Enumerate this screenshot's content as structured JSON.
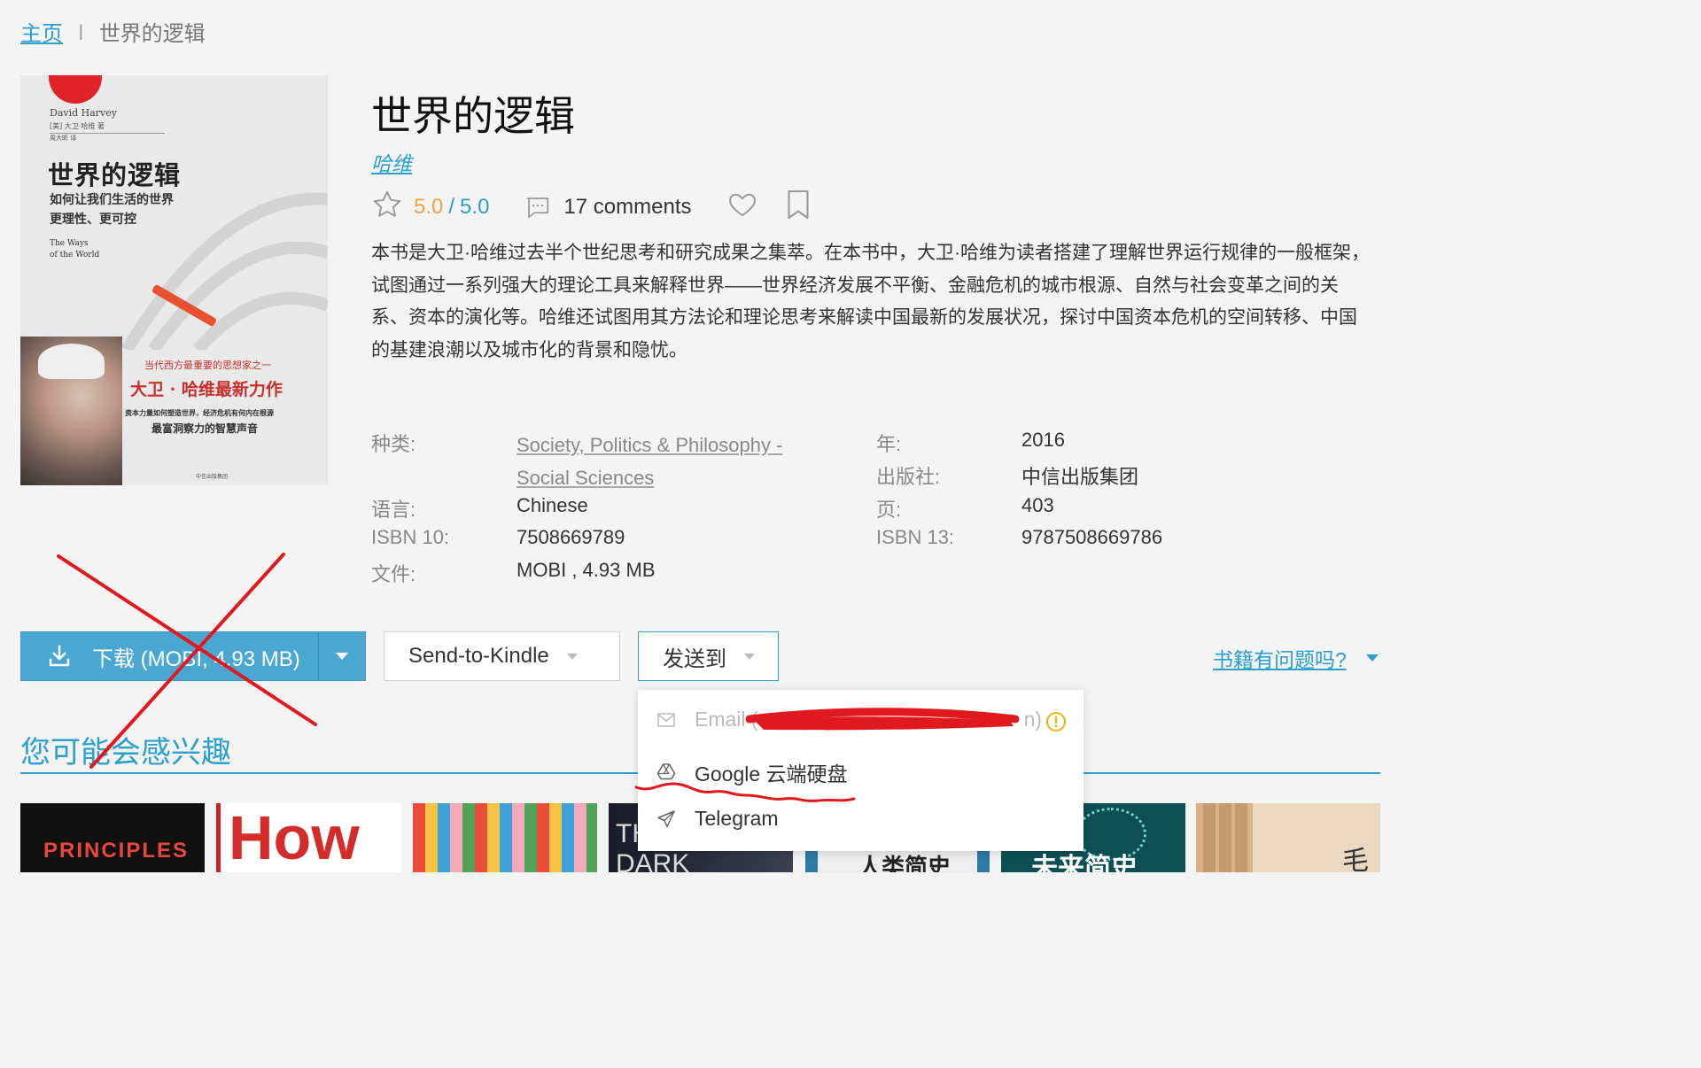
{
  "breadcrumb": {
    "home": "主页",
    "separator": "|",
    "current": "世界的逻辑"
  },
  "cover": {
    "author_en": "David Harvey",
    "author_cn": "[美] 大卫·哈维 著",
    "translator": "周大昕 译",
    "title": "世界的逻辑",
    "subtitle_line1": "如何让我们生活的世界",
    "subtitle_line2": "更理性、更可控",
    "title_en_line1": "The Ways",
    "title_en_line2": "of the World",
    "praise_line1": "当代西方最重要的思想家之一",
    "praise_line2": "大卫 · 哈维最新力作",
    "praise_line3": "资本力量如何塑造世界，经济危机有何内在根源",
    "praise_line4": "最富洞察力的智慧声音",
    "publisher": "中信出版集团"
  },
  "book": {
    "title": "世界的逻辑",
    "author": "哈维",
    "rating": "5.0",
    "rating_sep": "/",
    "rating_max": "5.0",
    "comments": "17 comments",
    "description": "本书是大卫·哈维过去半个世纪思考和研究成果之集萃。在本书中，大卫·哈维为读者搭建了理解世界运行规律的一般框架，试图通过一系列强大的理论工具来解释世界——世界经济发展不平衡、金融危机的城市根源、自然与社会变革之间的关系、资本的演化等。哈维还试图用其方法论和理论思考来解读中国最新的发展状况，探讨中国资本危机的空间转移、中国的基建浪潮以及城市化的背景和隐忧。"
  },
  "properties": {
    "category_label": "种类:",
    "category_line1": "Society, Politics & Philosophy -",
    "category_line2": "Social Sciences",
    "language_label": "语言:",
    "language": "Chinese",
    "isbn10_label": "ISBN 10:",
    "isbn10": "7508669789",
    "file_label": "文件:",
    "file": "MOBI , 4.93 MB",
    "year_label": "年:",
    "year": "2016",
    "publisher_label": "出版社:",
    "publisher": "中信出版集团",
    "pages_label": "页:",
    "pages": "403",
    "isbn13_label": "ISBN 13:",
    "isbn13": "9787508669786"
  },
  "actions": {
    "download": "下载 (MOBI, 4.93 MB)",
    "send_to_kindle": "Send-to-Kindle",
    "send_to": "发送到",
    "problem": "书籍有问题吗?"
  },
  "send_menu": {
    "email": "Email (",
    "email_tail": "n)",
    "google_drive": "Google 云端硬盘",
    "telegram": "Telegram"
  },
  "suggestions": {
    "title": "您可能会感兴趣",
    "items": [
      {
        "text": "PRINCIPLES"
      },
      {
        "text": "How"
      },
      {
        "text": ""
      },
      {
        "text": "THE DARK"
      },
      {
        "text": "人类简史"
      },
      {
        "text": "未来简史"
      },
      {
        "text": "毛"
      }
    ]
  },
  "colors": {
    "accent": "#2b9fcf",
    "rating": "#f0a23a",
    "download_bg": "#4aa7d1",
    "annotation": "#e0191f"
  }
}
